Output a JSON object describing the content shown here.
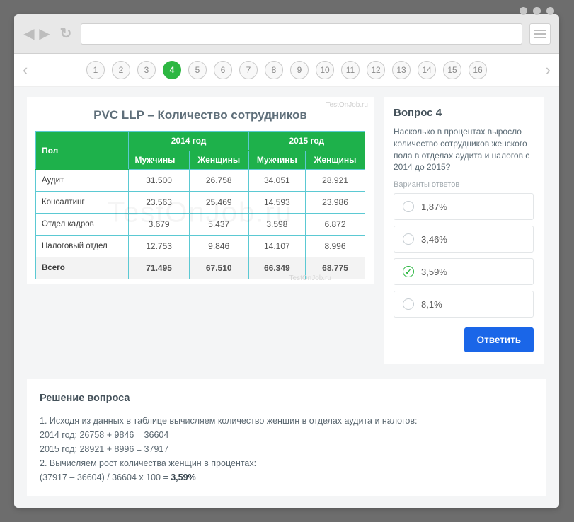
{
  "browser": {
    "url": ""
  },
  "nav": {
    "numbers": [
      "1",
      "2",
      "3",
      "4",
      "5",
      "6",
      "7",
      "8",
      "9",
      "10",
      "11",
      "12",
      "13",
      "14",
      "15",
      "16"
    ],
    "active": 4
  },
  "table": {
    "title": "PVC LLP – Количество сотрудников",
    "watermark": "TestOnJob.ru",
    "watermark_big": "TestOnJob.ru",
    "year1": "2014 год",
    "year2": "2015 год",
    "col_row": "Пол",
    "col_m": "Мужчины",
    "col_f": "Женщины",
    "rows": [
      {
        "label": "Аудит",
        "m14": "31.500",
        "f14": "26.758",
        "m15": "34.051",
        "f15": "28.921"
      },
      {
        "label": "Консалтинг",
        "m14": "23.563",
        "f14": "25.469",
        "m15": "14.593",
        "f15": "23.986"
      },
      {
        "label": "Отдел кадров",
        "m14": "3.679",
        "f14": "5.437",
        "m15": "3.598",
        "f15": "6.872"
      },
      {
        "label": "Налоговый отдел",
        "m14": "12.753",
        "f14": "9.846",
        "m15": "14.107",
        "f15": "8.996"
      }
    ],
    "total": {
      "label": "Всего",
      "m14": "71.495",
      "f14": "67.510",
      "m15": "66.349",
      "f15": "68.775"
    }
  },
  "question": {
    "heading": "Вопрос 4",
    "text": "Насколько в процентах выросло количество сотрудников женского пола в отделах аудита и налогов с 2014 до 2015?",
    "variants_label": "Варианты ответов",
    "options": [
      "1,87%",
      "3,46%",
      "3,59%",
      "8,1%"
    ],
    "selected": 2,
    "button": "Ответить"
  },
  "solution": {
    "heading": "Решение вопроса",
    "line1": "1. Исходя из данных в таблице вычисляем количество женщин в отделах аудита и налогов:",
    "line2": "2014 год: 26758 + 9846 = 36604",
    "line3": "2015 год: 28921 + 8996 = 37917",
    "line4": "2. Вычисляем рост количества женщин в процентах:",
    "line5_prefix": "(37917 – 36604) / 36604 x 100 = ",
    "line5_bold": "3,59%"
  }
}
